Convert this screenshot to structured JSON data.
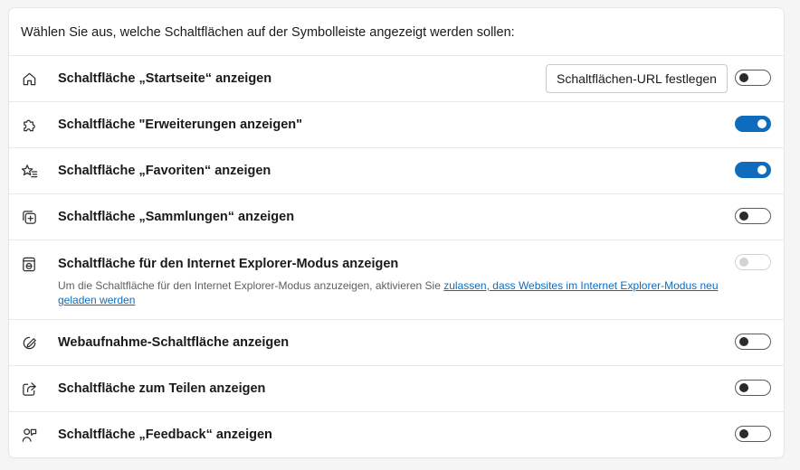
{
  "heading": "Wählen Sie aus, welche Schaltflächen auf der Symbolleiste angezeigt werden sollen:",
  "rows": [
    {
      "label": "Schaltfläche „Startseite“ anzeigen",
      "icon": "home-icon",
      "toggle": "off",
      "button_label": "Schaltflächen-URL festlegen"
    },
    {
      "label": "Schaltfläche \"Erweiterungen anzeigen\"",
      "icon": "puzzle-icon",
      "toggle": "on"
    },
    {
      "label": "Schaltfläche „Favoriten“ anzeigen",
      "icon": "favorites-star-icon",
      "toggle": "on"
    },
    {
      "label": "Schaltfläche „Sammlungen“ anzeigen",
      "icon": "collections-icon",
      "toggle": "off"
    },
    {
      "label": "Schaltfläche für den Internet Explorer-Modus anzeigen",
      "icon": "ie-mode-icon",
      "toggle": "disabled",
      "description": "Um die Schaltfläche für den Internet Explorer-Modus anzuzeigen, aktivieren Sie ",
      "link_text": "zulassen, dass Websites im Internet Explorer-Modus neu geladen werden"
    },
    {
      "label": "Webaufnahme-Schaltfläche anzeigen",
      "icon": "web-capture-icon",
      "toggle": "off"
    },
    {
      "label": "Schaltfläche zum Teilen anzeigen",
      "icon": "share-icon",
      "toggle": "off"
    },
    {
      "label": "Schaltfläche „Feedback“ anzeigen",
      "icon": "feedback-icon",
      "toggle": "off"
    }
  ],
  "colors": {
    "accent": "#0f6cbd",
    "text": "#1a1a1a",
    "secondary_text": "#5f5f5f",
    "background": "#f5f5f5"
  }
}
